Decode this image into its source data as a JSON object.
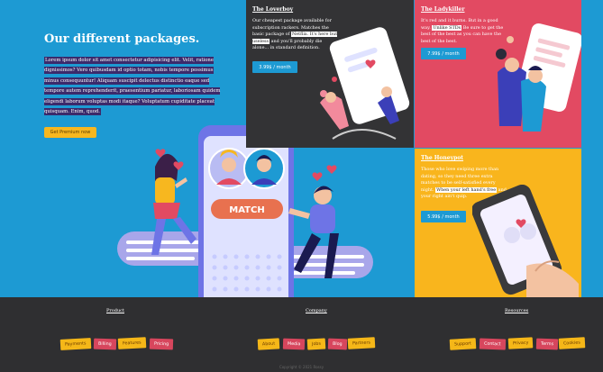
{
  "hero": {
    "title": "Our different packages.",
    "body": "Lorem ipsum dolor sit amet consectetur adipisicing elit. Velit, ratione dignissimos? Vero quibusdam id optio totam, nobis tempore possimus minus consequuntur! Aliquam suscipit delectus distinctio eaque sed tempore autem reprehenderit, praesentium pariatur, laboriosam quidem eligendi laborum voluptas modi itaque? Voluptatum cupiditate placeat quisquam. Enim, quod.",
    "cta": "Get Premium now",
    "match_label": "MATCH"
  },
  "packages": [
    {
      "title": "The Loverboy",
      "desc_1": "Our cheapest package available for subscription rackers. Matches the basic package of ",
      "desc_hl_1": "Netflix. It's here but useless",
      "desc_2": " and you'll probably die alone... in standard definition.",
      "price": "3.99$ / month"
    },
    {
      "title": "The Ladykiller",
      "desc_1": "It's red and it burns. But in a good way. ",
      "desc_hl_1": "Unlike STDs",
      "desc_2": " Be sure to get the best of the best as you can have the best of the best.",
      "price": "7.99$ / month"
    },
    {
      "title": "The Honeypot",
      "desc_1": "Those who love swiping more than dating, so they need three extra matches to be self-satisfied every night. ",
      "desc_hl_1": "When your left hand's free",
      "desc_2": " and your right ain't quip.",
      "price": "5.99$ / month"
    }
  ],
  "footer": {
    "columns": [
      {
        "title": "Product",
        "tags": [
          "Payments",
          "Billing",
          "Features",
          "Pricing"
        ]
      },
      {
        "title": "Company",
        "tags": [
          "About",
          "Media",
          "Jobs",
          "Blog",
          "Partners"
        ]
      },
      {
        "title": "Resources",
        "tags": [
          "Support",
          "Contact",
          "Privacy",
          "Terms",
          "Cookies"
        ]
      }
    ],
    "copyright": "Copyright © 2021 Rossy"
  },
  "colors": {
    "hero_bg": "#1d9ad3",
    "dark": "#333335",
    "pink": "#e24a62",
    "yellow": "#f9b51d"
  }
}
